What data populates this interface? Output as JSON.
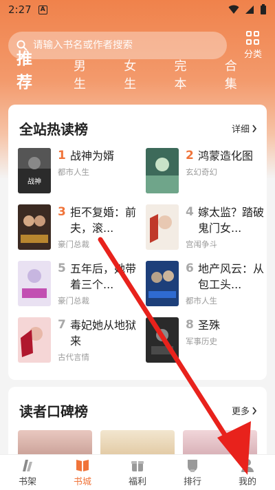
{
  "status": {
    "time": "2:27",
    "notif_letter": "A"
  },
  "search": {
    "placeholder": "请输入书名或作者搜索"
  },
  "category_label": "分类",
  "tabs": [
    {
      "label": "推荐",
      "active": true
    },
    {
      "label": "男生",
      "active": false
    },
    {
      "label": "女生",
      "active": false
    },
    {
      "label": "完本",
      "active": false
    },
    {
      "label": "合集",
      "active": false
    }
  ],
  "hot_chart": {
    "title": "全站热读榜",
    "more": "详细",
    "books": [
      {
        "rank": "1",
        "title": "战神为婿",
        "genre": "都市人生"
      },
      {
        "rank": "2",
        "title": "鸿蒙造化图",
        "genre": "玄幻奇幻"
      },
      {
        "rank": "3",
        "title": "拒不复婚：前夫，滚...",
        "genre": "豪门总裁"
      },
      {
        "rank": "4",
        "title": "嫁太监？踏破鬼门女...",
        "genre": "宫闱争斗"
      },
      {
        "rank": "5",
        "title": "五年后，她带着三个...",
        "genre": "豪门总裁"
      },
      {
        "rank": "6",
        "title": "地产风云：从包工头...",
        "genre": "都市人生"
      },
      {
        "rank": "7",
        "title": "毒妃她从地狱来",
        "genre": "古代言情"
      },
      {
        "rank": "8",
        "title": "圣殊",
        "genre": "军事历史"
      }
    ]
  },
  "praise_chart": {
    "title": "读者口碑榜",
    "more": "更多"
  },
  "tabbar": [
    {
      "label": "书架",
      "icon": "bookshelf-icon",
      "active": false
    },
    {
      "label": "书城",
      "icon": "book-icon",
      "active": true
    },
    {
      "label": "福利",
      "icon": "gift-icon",
      "active": false
    },
    {
      "label": "排行",
      "icon": "ranking-icon",
      "active": false
    },
    {
      "label": "我的",
      "icon": "user-icon",
      "active": false
    }
  ],
  "colors": {
    "accent": "#f0743a",
    "annotation_arrow": "#e8221c"
  }
}
